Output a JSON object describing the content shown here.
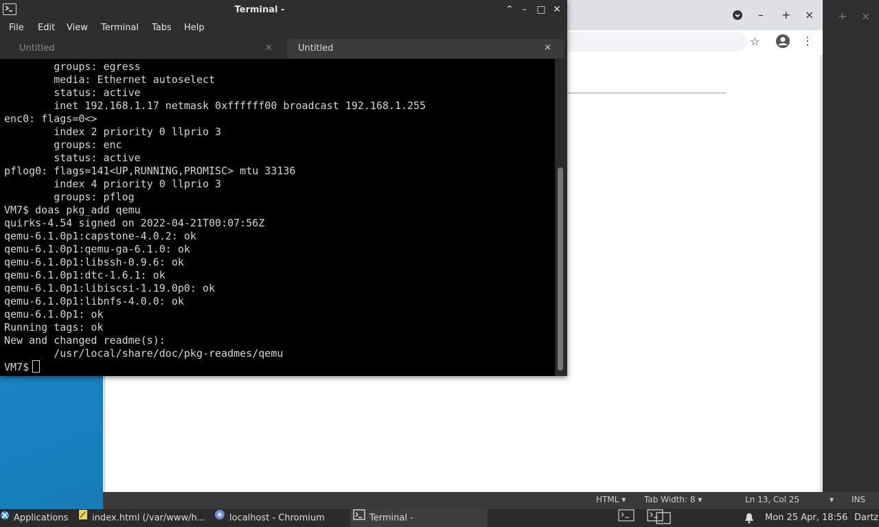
{
  "terminal": {
    "title": "Terminal -",
    "menu": [
      "File",
      "Edit",
      "View",
      "Terminal",
      "Tabs",
      "Help"
    ],
    "tabs": [
      {
        "label": "Untitled",
        "close": "×"
      },
      {
        "label": "Untitled",
        "close": "×"
      }
    ],
    "lines": [
      "        groups: egress",
      "        media: Ethernet autoselect",
      "        status: active",
      "        inet 192.168.1.17 netmask 0xffffff00 broadcast 192.168.1.255",
      "enc0: flags=0<>",
      "        index 2 priority 0 llprio 3",
      "        groups: enc",
      "        status: active",
      "pflog0: flags=141<UP,RUNNING,PROMISC> mtu 33136",
      "        index 4 priority 0 llprio 3",
      "        groups: pflog",
      "VM7$ doas pkg_add qemu",
      "quirks-4.54 signed on 2022-04-21T00:07:56Z",
      "qemu-6.1.0p1:capstone-4.0.2: ok",
      "qemu-6.1.0p1:qemu-ga-6.1.0: ok",
      "qemu-6.1.0p1:libssh-0.9.6: ok",
      "qemu-6.1.0p1:dtc-1.6.1: ok",
      "qemu-6.1.0p1:libiscsi-1.19.0p0: ok",
      "qemu-6.1.0p1:libnfs-4.0.0: ok",
      "qemu-6.1.0p1: ok",
      "Running tags: ok",
      "New and changed readme(s):",
      "        /usr/local/share/doc/pkg-readmes/qemu"
    ],
    "prompt": "VM7$"
  },
  "editor": {
    "status": {
      "language": "HTML",
      "tab_width": "Tab Width: 8",
      "position": "Ln 13, Col 25",
      "mode": "INS"
    }
  },
  "taskbar": {
    "applications": "Applications",
    "tasks": [
      "index.html (/var/www/h...",
      "localhost - Chromium",
      "Terminal -"
    ],
    "clock": "Mon 25 Apr, 18:56",
    "user": "Dartz"
  }
}
